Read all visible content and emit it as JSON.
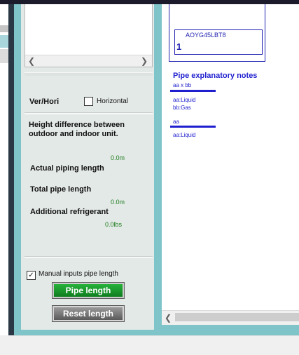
{
  "left_panel": {
    "ver_hori_label": "Ver/Hori",
    "horizontal_label": "Horizontal",
    "height_diff_label": "Height difference between outdoor and indoor unit.",
    "height_diff_value": "0.0m",
    "actual_piping_label": "Actual piping length",
    "total_pipe_label": "Total pipe length",
    "total_pipe_value": "0.0m",
    "additional_refrigerant_label": "Additional refrigerant",
    "additional_refrigerant_value": "0.0lbs",
    "manual_inputs_label": "Manual inputs pipe length",
    "manual_inputs_checked": true,
    "pipe_length_button": "Pipe length",
    "reset_length_button": "Reset length"
  },
  "canvas": {
    "unit_model": "AOYG45LBT8",
    "unit_number": "1",
    "notes_title": "Pipe explanatory notes",
    "note1_header": "aa x bb",
    "note1_line1": "aa:Liquid",
    "note1_line2": "bb:Gas",
    "note2_header": "aa",
    "note2_line1": "aa:Liquid"
  },
  "colors": {
    "teal_frame": "#7ec4c9",
    "panel_bg": "#e3e9e7",
    "value_green": "#1e7d1e",
    "note_blue": "#1f1fd0",
    "button_green": "#1a9c2c"
  },
  "icons": {
    "scroll_left": "chevron-left-icon",
    "scroll_right": "chevron-right-icon",
    "checkmark": "checkmark-icon"
  }
}
